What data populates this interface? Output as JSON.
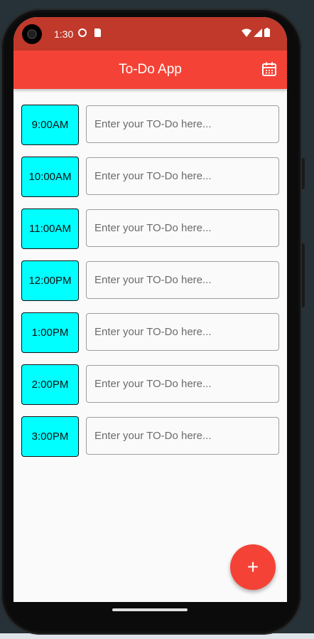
{
  "status_bar": {
    "time": "1:30",
    "icons": [
      "settings-icon",
      "sd-card-icon",
      "wifi-icon",
      "signal-icon",
      "battery-icon"
    ]
  },
  "app_bar": {
    "title": "To-Do App",
    "action_icon": "calendar-icon",
    "color": "#f44336"
  },
  "schedule": {
    "placeholder": "Enter your TO-Do here...",
    "slot_color": "#00ffff",
    "slots": [
      {
        "time": "9:00 AM",
        "value": ""
      },
      {
        "time": "10:00 AM",
        "value": ""
      },
      {
        "time": "11:00 AM",
        "value": ""
      },
      {
        "time": "12:00 PM",
        "value": ""
      },
      {
        "time": "1:00 PM",
        "value": ""
      },
      {
        "time": "2:00 PM",
        "value": ""
      },
      {
        "time": "3:00 PM",
        "value": ""
      }
    ]
  },
  "fab": {
    "icon": "plus-icon",
    "label": "+"
  }
}
